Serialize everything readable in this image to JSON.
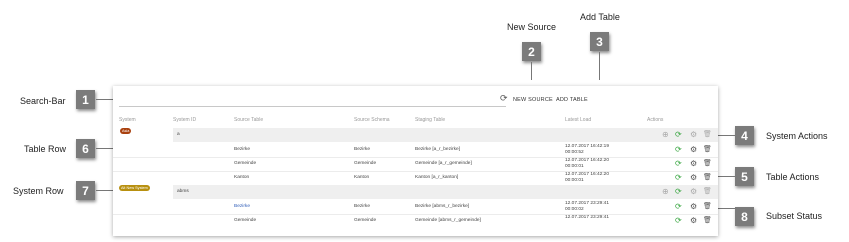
{
  "callouts": {
    "new_source": "New Source",
    "add_table": "Add Table",
    "search_bar": "Search-Bar",
    "table_row": "Table Row",
    "system_row": "System Row",
    "system_actions": "System Actions",
    "table_actions": "Table Actions",
    "subset_status": "Subset Status",
    "n1": "1",
    "n2": "2",
    "n3": "3",
    "n4": "4",
    "n5": "5",
    "n6": "6",
    "n7": "7",
    "n8": "8"
  },
  "toolbar": {
    "search_placeholder": "",
    "refresh_glyph": "⟳",
    "new_source": "NEW SOURCE",
    "add_table": "ADD TABLE"
  },
  "headers": {
    "system": "System",
    "system_id": "System ID",
    "source_table": "Source Table",
    "source_schema": "Source Schema",
    "staging_table": "Staging Table",
    "latest_load": "Latest Load",
    "actions": "Actions"
  },
  "systems": [
    {
      "badge": "Asia",
      "badge_color": "#a9410f",
      "id": "a",
      "tables": [
        {
          "source": "Bezirke",
          "schema": "Bezirke",
          "staging": "Bezirke [a_r_bezirke]",
          "load1": "12.07.2017 16:42:19",
          "load2": "00:00:52"
        },
        {
          "source": "Gemeinde",
          "schema": "Gemeinde",
          "staging": "Gemeinde [a_r_gemeinde]",
          "load1": "12.07.2017 16:42:20",
          "load2": "00:00:01"
        },
        {
          "source": "Kanton",
          "schema": "Kanton",
          "staging": "Kanton [a_r_kanton]",
          "load1": "12.07.2017 16:42:20",
          "load2": "00:00:01"
        }
      ]
    },
    {
      "badge": "Alt New System",
      "badge_color": "#b8900f",
      "id": "abms",
      "tables": [
        {
          "source": "Bezirke",
          "schema": "Bezirke",
          "staging": "Bezirke [abms_r_bezirke]",
          "load1": "12.07.2017 23:29:41",
          "load2": "00:00:02"
        },
        {
          "source": "Gemeinde",
          "schema": "Gemeinde",
          "staging": "Gemeinde [abms_r_gemeinde]",
          "load1": "12.07.2017 23:29:41",
          "load2": ""
        }
      ]
    }
  ],
  "icons": {
    "add": "⊕",
    "refresh": "⟳",
    "settings": "⚙",
    "delete": "🗑"
  },
  "colors": {
    "accent_green": "#3aa642",
    "badge_gray": "#7b7b7b",
    "link_blue": "#2f5db8"
  }
}
